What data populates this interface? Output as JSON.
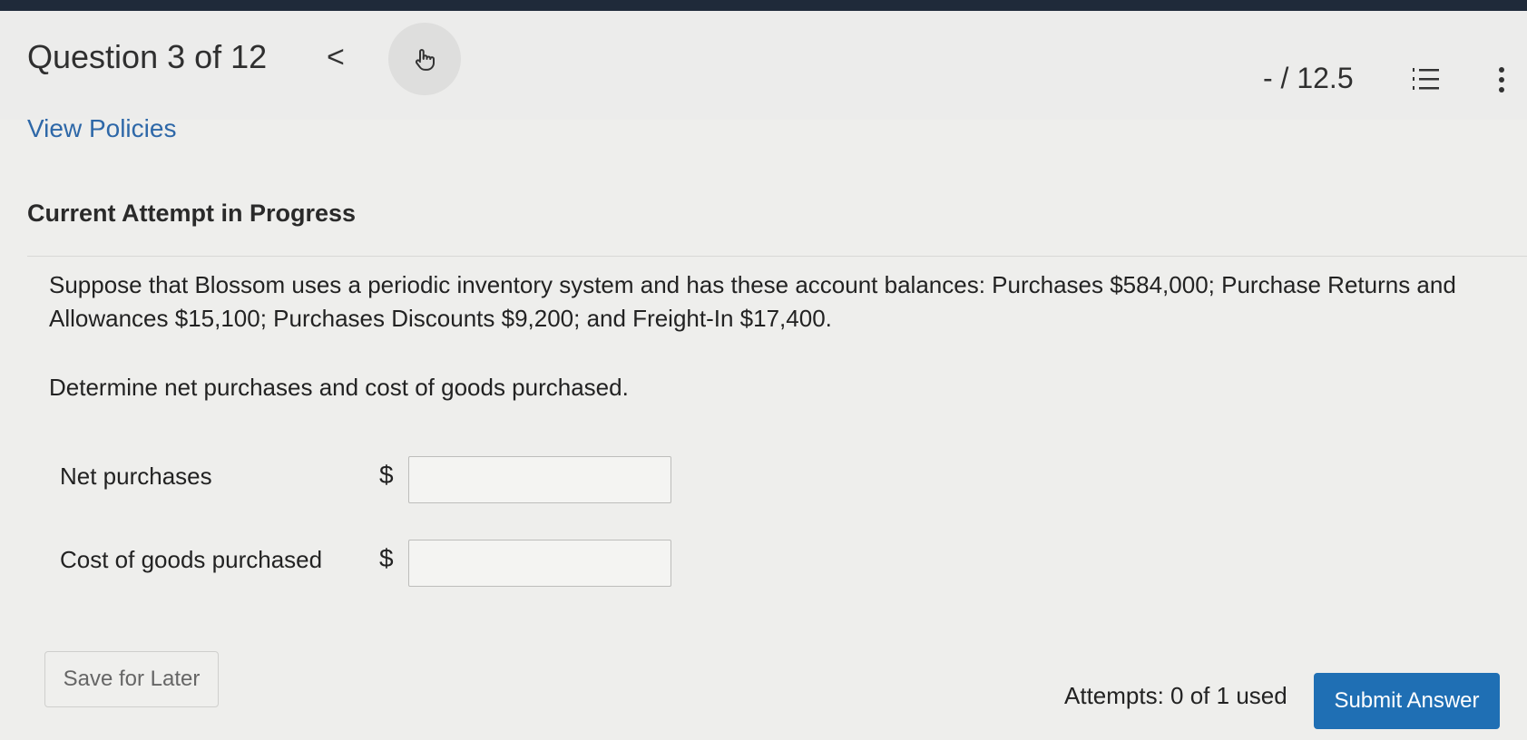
{
  "header": {
    "question_label": "Question 3 of 12",
    "prev_glyph": "<",
    "score": "- / 12.5",
    "icons": [
      "chevron-left-icon",
      "hand-pointer-icon",
      "list-icon",
      "more-vertical-icon"
    ]
  },
  "policies_link": "View Policies",
  "attempt_title": "Current Attempt in Progress",
  "question": {
    "body": "Suppose that Blossom uses a periodic inventory system and has these account balances: Purchases $584,000; Purchase Returns and Allowances $15,100; Purchases Discounts $9,200; and Freight-In $17,400.",
    "instruction": "Determine net purchases and cost of goods purchased."
  },
  "fields": [
    {
      "label": "Net purchases",
      "currency": "$",
      "value": ""
    },
    {
      "label": "Cost of goods purchased",
      "currency": "$",
      "value": ""
    }
  ],
  "footer": {
    "save_label": "Save for Later",
    "attempts": "Attempts: 0 of 1 used",
    "submit_label": "Submit Answer"
  },
  "colors": {
    "link": "#2e68a8",
    "submit_bg": "#1f6fb4",
    "background": "#eeeeec"
  }
}
